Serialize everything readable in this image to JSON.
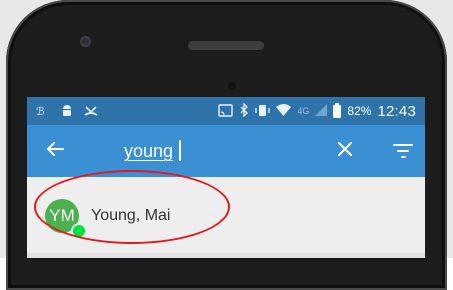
{
  "status_bar": {
    "left_icons": [
      "signal-booster-icon",
      "android-icon",
      "missed-call-icon"
    ],
    "right_icons": [
      "cast-icon",
      "bluetooth-icon",
      "vibrate-icon",
      "wifi-icon"
    ],
    "network_label": "4G",
    "battery_percent": "82%",
    "time": "12:43"
  },
  "search": {
    "query": "young",
    "back_icon": "arrow-back-icon",
    "clear_icon": "close-icon",
    "filter_icon": "filter-icon"
  },
  "results": [
    {
      "initials": "YM",
      "name": "Young, Mai",
      "presence": "online"
    }
  ],
  "colors": {
    "status_bar": "#2f73ab",
    "app_bar": "#3b8fd3",
    "avatar": "#4caf50",
    "presence_online": "#00e23d",
    "annotation": "#e21a1a"
  }
}
